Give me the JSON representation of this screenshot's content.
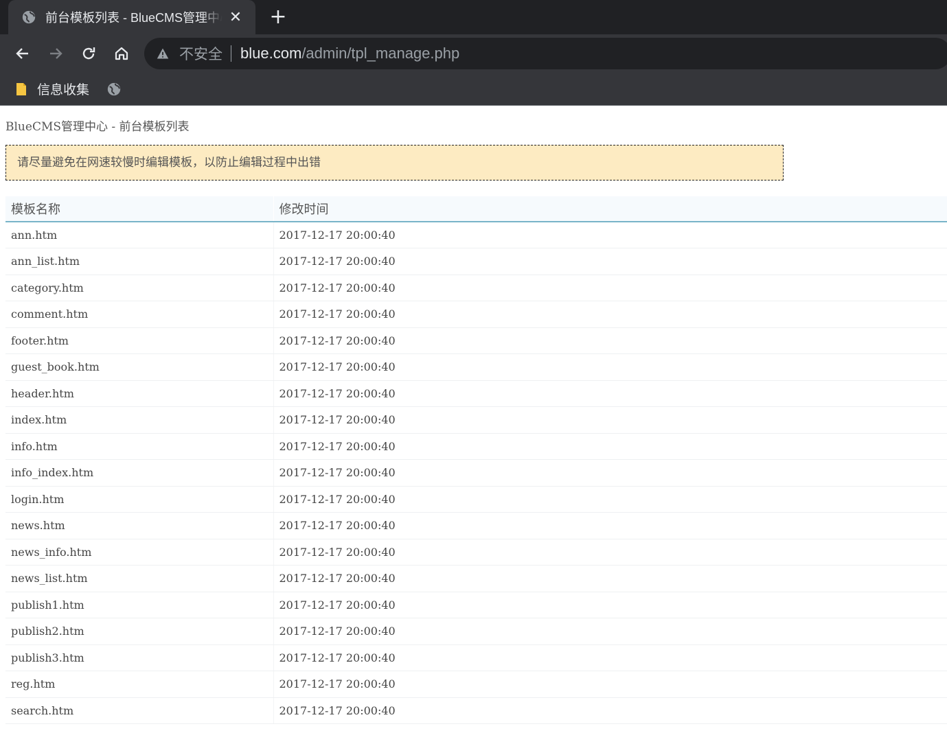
{
  "browser": {
    "tab_title": "前台模板列表 - BlueCMS管理中心",
    "close_icon": "close-icon",
    "new_tab_icon": "plus-icon",
    "security_label": "不安全",
    "url_host": "blue.com",
    "url_path": "/admin/tpl_manage.php",
    "bookmark_folder": "信息收集"
  },
  "page": {
    "breadcrumb": "BlueCMS管理中心 - 前台模板列表",
    "notice": "请尽量避免在网速较慢时编辑模板，以防止编辑过程中出错"
  },
  "table": {
    "headers": [
      "模板名称",
      "修改时间"
    ],
    "rows": [
      {
        "name": "ann.htm",
        "time": "2017-12-17 20:00:40"
      },
      {
        "name": "ann_list.htm",
        "time": "2017-12-17 20:00:40"
      },
      {
        "name": "category.htm",
        "time": "2017-12-17 20:00:40"
      },
      {
        "name": "comment.htm",
        "time": "2017-12-17 20:00:40"
      },
      {
        "name": "footer.htm",
        "time": "2017-12-17 20:00:40"
      },
      {
        "name": "guest_book.htm",
        "time": "2017-12-17 20:00:40"
      },
      {
        "name": "header.htm",
        "time": "2017-12-17 20:00:40"
      },
      {
        "name": "index.htm",
        "time": "2017-12-17 20:00:40"
      },
      {
        "name": "info.htm",
        "time": "2017-12-17 20:00:40"
      },
      {
        "name": "info_index.htm",
        "time": "2017-12-17 20:00:40"
      },
      {
        "name": "login.htm",
        "time": "2017-12-17 20:00:40"
      },
      {
        "name": "news.htm",
        "time": "2017-12-17 20:00:40"
      },
      {
        "name": "news_info.htm",
        "time": "2017-12-17 20:00:40"
      },
      {
        "name": "news_list.htm",
        "time": "2017-12-17 20:00:40"
      },
      {
        "name": "publish1.htm",
        "time": "2017-12-17 20:00:40"
      },
      {
        "name": "publish2.htm",
        "time": "2017-12-17 20:00:40"
      },
      {
        "name": "publish3.htm",
        "time": "2017-12-17 20:00:40"
      },
      {
        "name": "reg.htm",
        "time": "2017-12-17 20:00:40"
      },
      {
        "name": "search.htm",
        "time": "2017-12-17 20:00:40"
      }
    ]
  },
  "colors": {
    "chrome_dark": "#202124",
    "chrome_mid": "#35363a",
    "notice_bg": "#fdebc2",
    "header_underline": "#78b4c8"
  }
}
